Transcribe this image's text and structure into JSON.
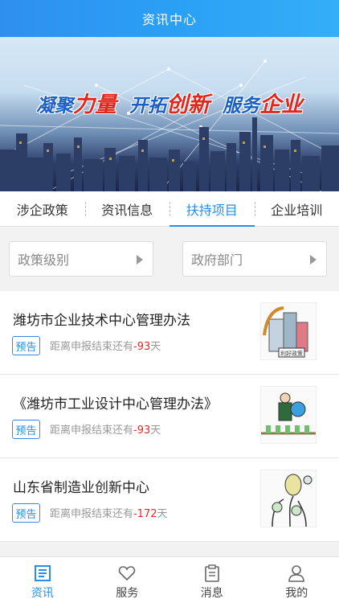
{
  "header": {
    "title": "资讯中心"
  },
  "banner": {
    "slogan": [
      "凝聚",
      "力量",
      "开拓",
      "创新",
      "服务",
      "企业"
    ]
  },
  "tabs": [
    {
      "label": "涉企政策",
      "active": false
    },
    {
      "label": "资讯信息",
      "active": false
    },
    {
      "label": "扶持项目",
      "active": true
    },
    {
      "label": "企业培训",
      "active": false
    }
  ],
  "filters": {
    "level": "政策级别",
    "department": "政府部门"
  },
  "items": [
    {
      "title": "潍坊市企业技术中心管理办法",
      "badge": "预告",
      "prefix": "距离申报结束还有",
      "days": "-93",
      "suffix": "天",
      "thumb_caption": "利好政策"
    },
    {
      "title": "《潍坊市工业设计中心管理办法》",
      "badge": "预告",
      "prefix": "距离申报结束还有",
      "days": "-93",
      "suffix": "天"
    },
    {
      "title": "山东省制造业创新中心",
      "badge": "预告",
      "prefix": "距离申报结束还有",
      "days": "-172",
      "suffix": "天"
    }
  ],
  "tabbar": [
    {
      "label": "资讯",
      "icon": "news-icon",
      "active": true
    },
    {
      "label": "服务",
      "icon": "heart-icon",
      "active": false
    },
    {
      "label": "消息",
      "icon": "clipboard-icon",
      "active": false
    },
    {
      "label": "我的",
      "icon": "user-icon",
      "active": false
    }
  ],
  "colors": {
    "primary": "#2a8ee8",
    "warning": "#e02b2b",
    "slogan_blue": "#1a5fc6",
    "slogan_red": "#e0261d"
  }
}
